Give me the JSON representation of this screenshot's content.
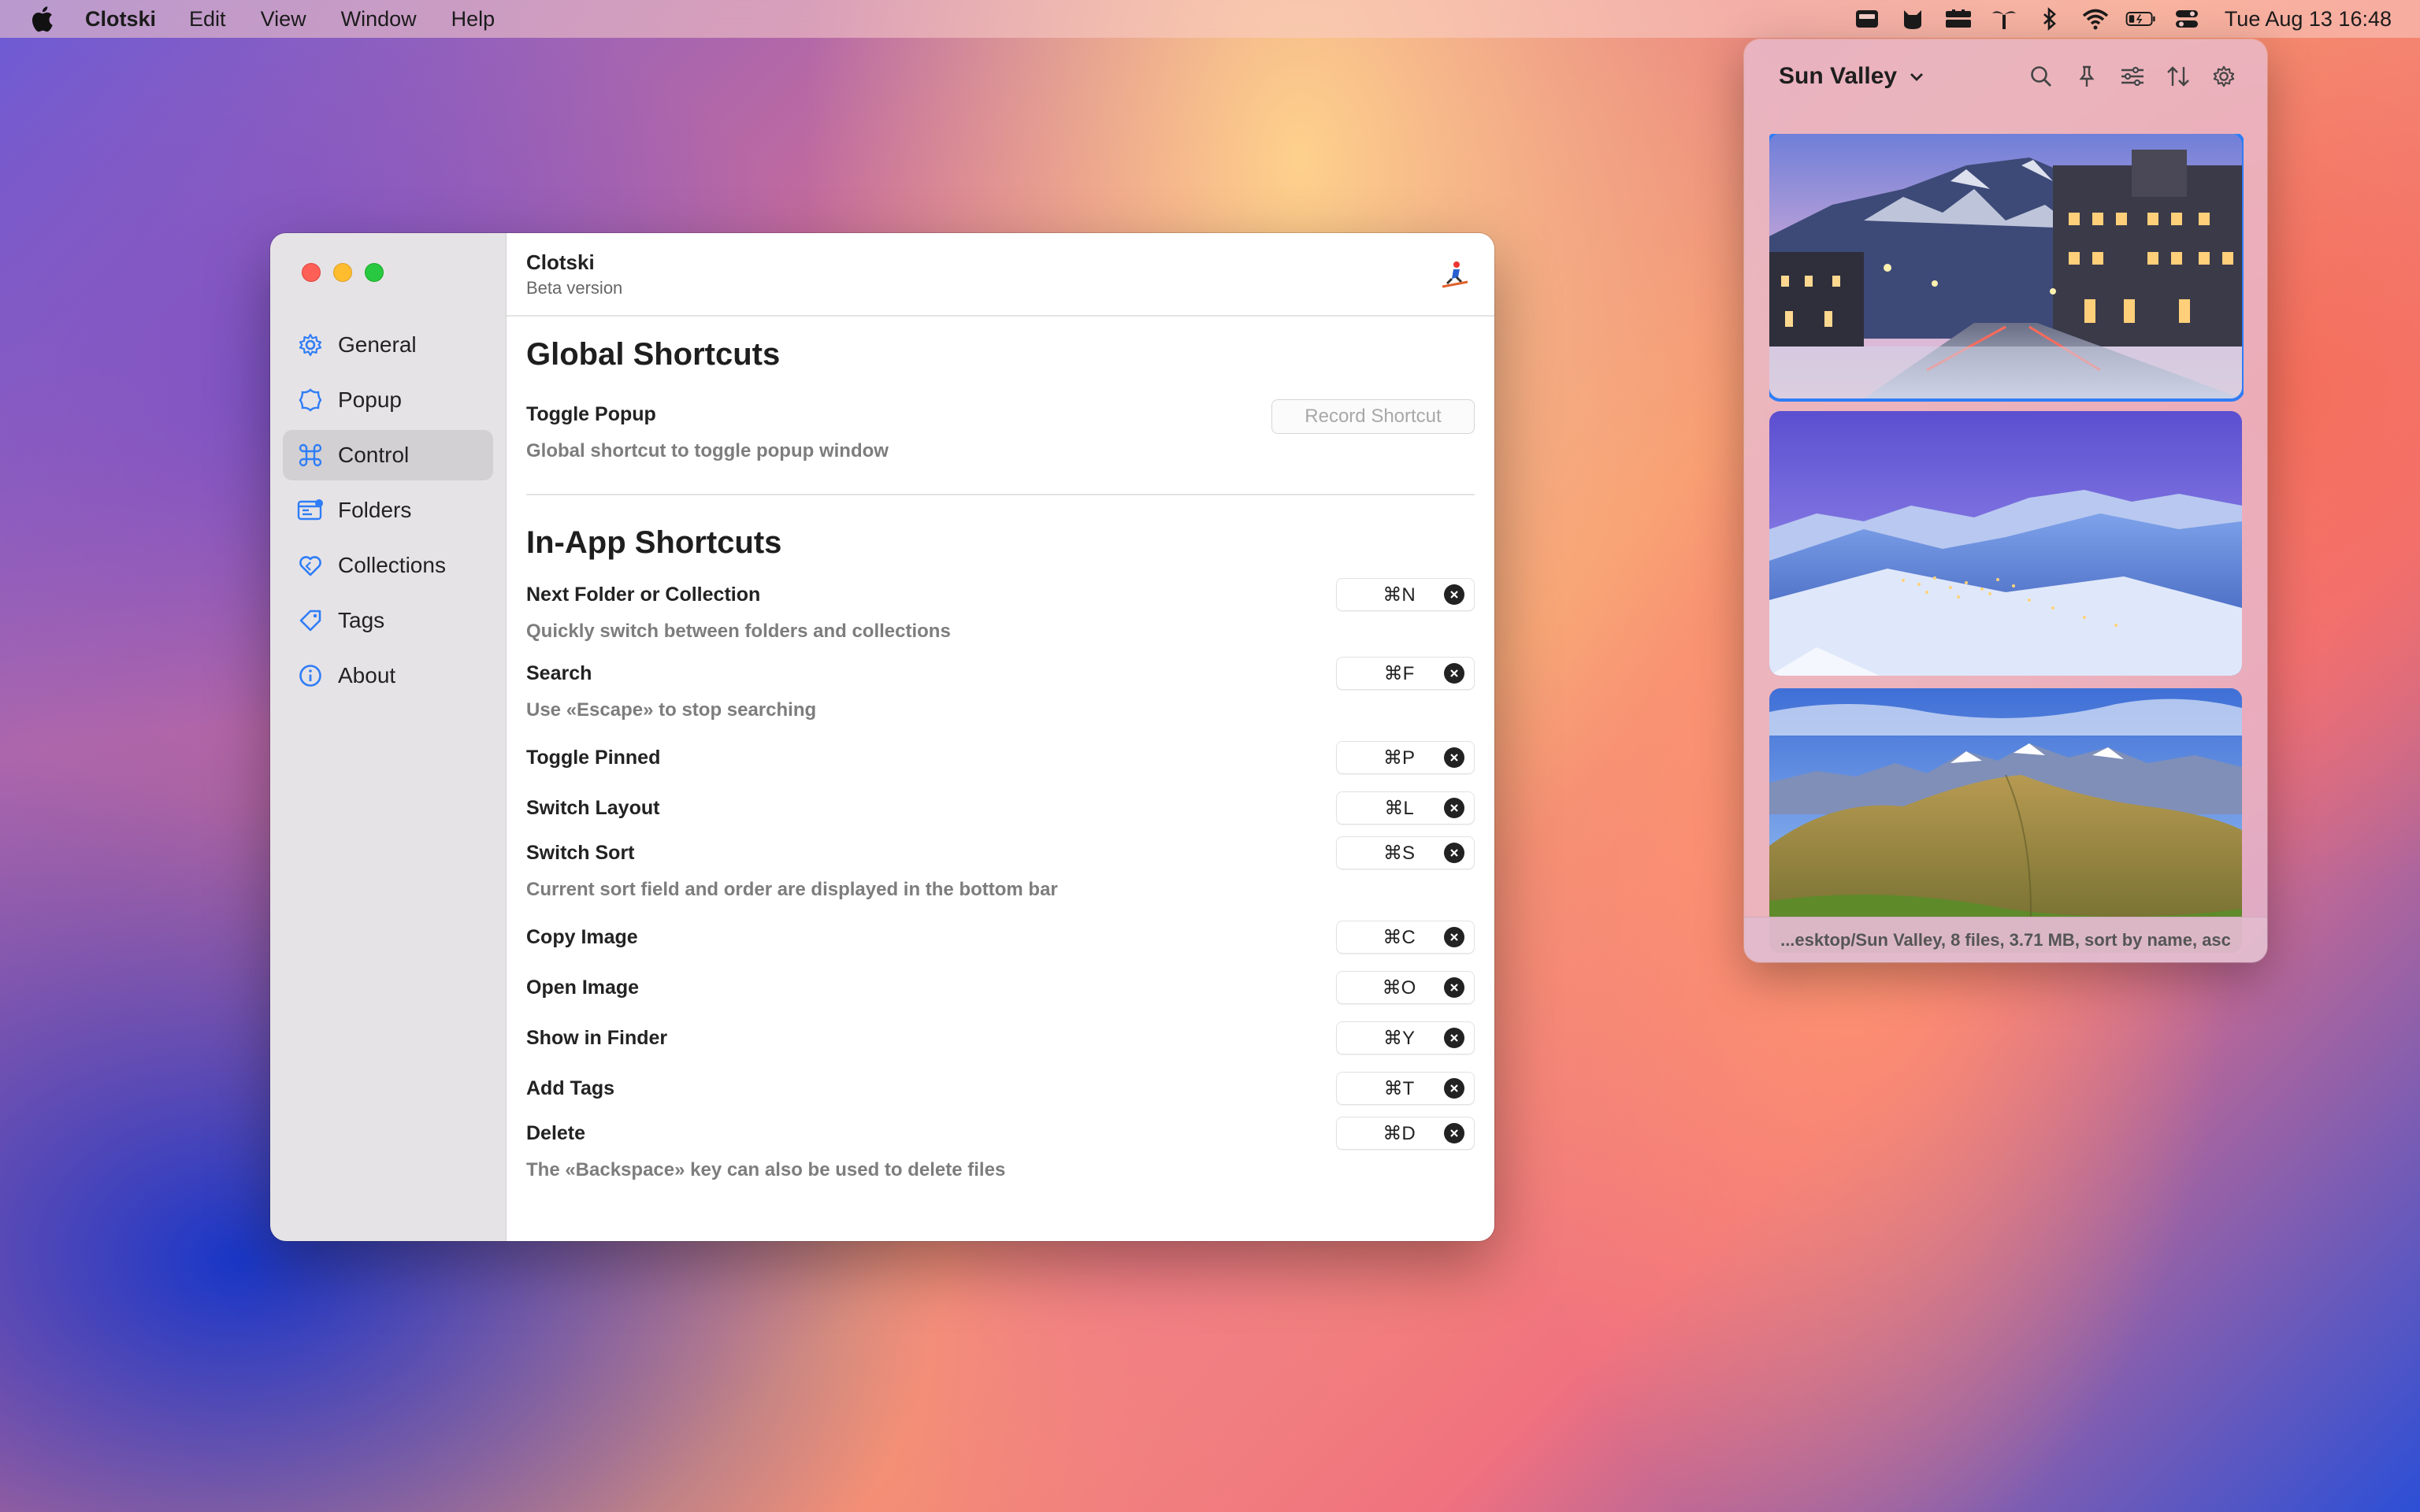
{
  "menubar": {
    "app_name": "Clotski",
    "menus": [
      "Edit",
      "View",
      "Window",
      "Help"
    ],
    "clock": "Tue Aug 13  16:48",
    "status_icons": [
      "inbox-icon",
      "cat-icon",
      "hub-icon",
      "palm-tree-icon",
      "bluetooth-icon",
      "wifi-icon",
      "battery-icon",
      "control-center-icon"
    ]
  },
  "window": {
    "header": {
      "app_name": "Clotski",
      "subtitle": "Beta version"
    },
    "sidebar": {
      "items": [
        {
          "label": "General",
          "icon": "gear-icon",
          "active": false
        },
        {
          "label": "Popup",
          "icon": "popup-icon",
          "active": false
        },
        {
          "label": "Control",
          "icon": "command-icon",
          "active": true
        },
        {
          "label": "Folders",
          "icon": "folders-icon",
          "active": false
        },
        {
          "label": "Collections",
          "icon": "heart-icon",
          "active": false
        },
        {
          "label": "Tags",
          "icon": "tag-icon",
          "active": false
        },
        {
          "label": "About",
          "icon": "info-icon",
          "active": false
        }
      ]
    },
    "global": {
      "title": "Global Shortcuts",
      "toggle_label": "Toggle Popup",
      "toggle_desc": "Global shortcut to toggle popup window",
      "record_placeholder": "Record Shortcut"
    },
    "inapp": {
      "title": "In-App Shortcuts",
      "shortcuts": [
        {
          "label": "Next Folder or Collection",
          "keys": "⌘N",
          "desc": "Quickly switch between folders and collections"
        },
        {
          "label": "Search",
          "keys": "⌘F",
          "desc": "Use «Escape» to stop searching"
        },
        {
          "label": "Toggle Pinned",
          "keys": "⌘P",
          "desc": ""
        },
        {
          "label": "Switch Layout",
          "keys": "⌘L",
          "desc": ""
        },
        {
          "label": "Switch Sort",
          "keys": "⌘S",
          "desc": "Current sort field and order are displayed in the bottom bar"
        },
        {
          "label": "Copy Image",
          "keys": "⌘C",
          "desc": ""
        },
        {
          "label": "Open Image",
          "keys": "⌘O",
          "desc": ""
        },
        {
          "label": "Show in Finder",
          "keys": "⌘Y",
          "desc": ""
        },
        {
          "label": "Add Tags",
          "keys": "⌘T",
          "desc": ""
        },
        {
          "label": "Delete",
          "keys": "⌘D",
          "desc": "The «Backspace» key can also be used to delete files"
        }
      ]
    }
  },
  "popup": {
    "title": "Sun Valley",
    "tools": [
      "search-icon",
      "pin-icon",
      "filter-icon",
      "sort-icon",
      "gear-icon"
    ],
    "footer": "...esktop/Sun Valley, 8 files, 3.71 MB, sort by name, asc",
    "thumbnails": [
      "sun-valley-town-night",
      "sun-valley-snowy-valley",
      "sun-valley-green-hills"
    ]
  }
}
